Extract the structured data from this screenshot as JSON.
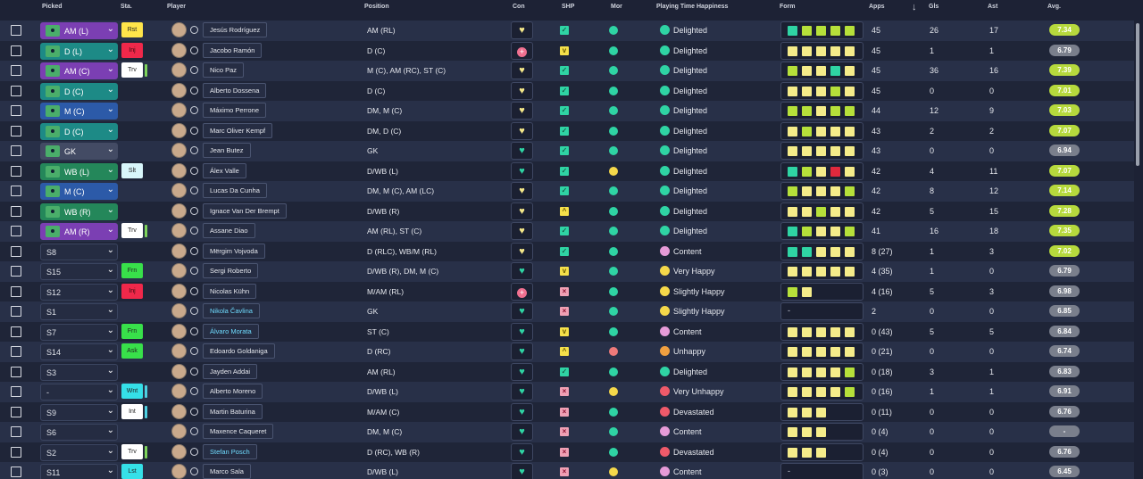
{
  "header": {
    "picked": "Picked",
    "sta": "Sta.",
    "player": "Player",
    "position": "Position",
    "con": "Con",
    "shp": "SHP",
    "mor": "Mor",
    "pth": "Playing Time Happiness",
    "form": "Form",
    "apps": "Apps",
    "sort": "↓",
    "gls": "Gls",
    "ast": "Ast",
    "avg": "Avg."
  },
  "colors": {
    "pick_purple": "#7b3fb3",
    "pick_teal": "#1d8a86",
    "pick_green": "#24875a",
    "pick_blue": "#2c5aa8",
    "pick_slate": "#434b64",
    "form_yellow": "#f5ec8a",
    "form_lime": "#b6e03a",
    "form_teal": "#2fd4a4",
    "form_red": "#e0293d",
    "sta_yellow": "#ffe54a",
    "sta_red": "#f0284a",
    "sta_white": "#ffffff",
    "sta_lightcyan": "#d8f6fa",
    "sta_green": "#38e04a",
    "sta_cyan": "#35e0e8"
  },
  "rows": [
    {
      "pick": "AM (L)",
      "pc": "purple",
      "sta": "Rst",
      "sc": "yellow",
      "bar": "",
      "name": "Jesús Rodríguez",
      "cyan": false,
      "pos": "AM (RL)",
      "con": "heart-yellow",
      "shp": "check",
      "mor": "teal",
      "pth": "Delighted",
      "pthc": "teal",
      "form": [
        "teal",
        "lime",
        "lime",
        "lime",
        "lime"
      ],
      "apps": "45",
      "gls": "26",
      "ast": "17",
      "avg": "7.34",
      "ac": "gr"
    },
    {
      "pick": "D (L)",
      "pc": "teal",
      "sta": "Inj",
      "sc": "red",
      "bar": "",
      "name": "Jacobo Ramón",
      "cyan": false,
      "pos": "D (C)",
      "con": "plus-red",
      "shp": "down",
      "mor": "teal",
      "pth": "Delighted",
      "pthc": "teal",
      "form": [
        "yellow",
        "yellow",
        "yellow",
        "yellow",
        "yellow"
      ],
      "apps": "45",
      "gls": "1",
      "ast": "1",
      "avg": "6.79",
      "ac": "gy"
    },
    {
      "pick": "AM (C)",
      "pc": "purple",
      "sta": "Trv",
      "sc": "white",
      "bar": "g",
      "name": "Nico Paz",
      "cyan": false,
      "pos": "M (C), AM (RC), ST (C)",
      "con": "heart-yellow",
      "shp": "check",
      "mor": "teal",
      "pth": "Delighted",
      "pthc": "teal",
      "form": [
        "lime",
        "yellow",
        "yellow",
        "teal",
        "yellow"
      ],
      "apps": "45",
      "gls": "36",
      "ast": "16",
      "avg": "7.39",
      "ac": "gr"
    },
    {
      "pick": "D (C)",
      "pc": "teal",
      "sta": "",
      "sc": "",
      "bar": "",
      "name": "Alberto Dossena",
      "cyan": false,
      "pos": "D (C)",
      "con": "heart-yellow",
      "shp": "check",
      "mor": "teal",
      "pth": "Delighted",
      "pthc": "teal",
      "form": [
        "yellow",
        "yellow",
        "yellow",
        "lime",
        "yellow"
      ],
      "apps": "45",
      "gls": "0",
      "ast": "0",
      "avg": "7.01",
      "ac": "gr"
    },
    {
      "pick": "M (C)",
      "pc": "blue",
      "sta": "",
      "sc": "",
      "bar": "",
      "name": "Máximo Perrone",
      "cyan": false,
      "pos": "DM, M (C)",
      "con": "heart-yellow",
      "shp": "check",
      "mor": "teal",
      "pth": "Delighted",
      "pthc": "teal",
      "form": [
        "lime",
        "lime",
        "yellow",
        "lime",
        "lime"
      ],
      "apps": "44",
      "gls": "12",
      "ast": "9",
      "avg": "7.03",
      "ac": "gr"
    },
    {
      "pick": "D (C)",
      "pc": "teal",
      "sta": "",
      "sc": "",
      "bar": "",
      "name": "Marc Oliver Kempf",
      "cyan": false,
      "pos": "DM, D (C)",
      "con": "heart-yellow",
      "shp": "check",
      "mor": "teal",
      "pth": "Delighted",
      "pthc": "teal",
      "form": [
        "yellow",
        "lime",
        "yellow",
        "yellow",
        "yellow"
      ],
      "apps": "43",
      "gls": "2",
      "ast": "2",
      "avg": "7.07",
      "ac": "gr"
    },
    {
      "pick": "GK",
      "pc": "slate",
      "sta": "",
      "sc": "",
      "bar": "",
      "name": "Jean Butez",
      "cyan": false,
      "pos": "GK",
      "con": "heart-teal",
      "shp": "check",
      "mor": "teal",
      "pth": "Delighted",
      "pthc": "teal",
      "form": [
        "yellow",
        "yellow",
        "yellow",
        "yellow",
        "yellow"
      ],
      "apps": "43",
      "gls": "0",
      "ast": "0",
      "avg": "6.94",
      "ac": "gy"
    },
    {
      "pick": "WB (L)",
      "pc": "green",
      "sta": "Slt",
      "sc": "lightcyan",
      "bar": "",
      "name": "Álex Valle",
      "cyan": false,
      "pos": "D/WB (L)",
      "con": "heart-teal",
      "shp": "check",
      "mor": "yellow",
      "pth": "Delighted",
      "pthc": "teal",
      "form": [
        "teal",
        "lime",
        "yellow",
        "red",
        "yellow"
      ],
      "apps": "42",
      "gls": "4",
      "ast": "11",
      "avg": "7.07",
      "ac": "gr"
    },
    {
      "pick": "M (C)",
      "pc": "blue",
      "sta": "",
      "sc": "",
      "bar": "",
      "name": "Lucas Da Cunha",
      "cyan": false,
      "pos": "DM, M (C), AM (LC)",
      "con": "heart-yellow",
      "shp": "check",
      "mor": "teal",
      "pth": "Delighted",
      "pthc": "teal",
      "form": [
        "lime",
        "yellow",
        "yellow",
        "yellow",
        "lime"
      ],
      "apps": "42",
      "gls": "8",
      "ast": "12",
      "avg": "7.14",
      "ac": "gr"
    },
    {
      "pick": "WB (R)",
      "pc": "green",
      "sta": "",
      "sc": "",
      "bar": "",
      "name": "Ignace Van Der Brempt",
      "cyan": false,
      "pos": "D/WB (R)",
      "con": "heart-yellow",
      "shp": "up",
      "mor": "teal",
      "pth": "Delighted",
      "pthc": "teal",
      "form": [
        "yellow",
        "yellow",
        "lime",
        "yellow",
        "yellow"
      ],
      "apps": "42",
      "gls": "5",
      "ast": "15",
      "avg": "7.28",
      "ac": "gr"
    },
    {
      "pick": "AM (R)",
      "pc": "purple",
      "sta": "Trv",
      "sc": "white",
      "bar": "y",
      "name": "Assane Diao",
      "cyan": false,
      "pos": "AM (RL), ST (C)",
      "con": "heart-yellow",
      "shp": "check",
      "mor": "teal",
      "pth": "Delighted",
      "pthc": "teal",
      "form": [
        "teal",
        "lime",
        "yellow",
        "yellow",
        "lime"
      ],
      "apps": "41",
      "gls": "16",
      "ast": "18",
      "avg": "7.35",
      "ac": "gr"
    },
    {
      "pick": "S8",
      "pc": "plain",
      "sta": "",
      "sc": "",
      "bar": "",
      "name": "Mërgim Vojvoda",
      "cyan": false,
      "pos": "D (RLC), WB/M (RL)",
      "con": "heart-yellow",
      "shp": "check",
      "mor": "teal",
      "pth": "Content",
      "pthc": "pink",
      "form": [
        "teal",
        "teal",
        "yellow",
        "yellow",
        "yellow"
      ],
      "apps": "8 (27)",
      "gls": "1",
      "ast": "3",
      "avg": "7.02",
      "ac": "gr"
    },
    {
      "pick": "S15",
      "pc": "plain",
      "sta": "Frn",
      "sc": "green",
      "bar": "",
      "name": "Sergi Roberto",
      "cyan": false,
      "pos": "D/WB (R), DM, M (C)",
      "con": "heart-teal",
      "shp": "down",
      "mor": "teal",
      "pth": "Very Happy",
      "pthc": "yellow",
      "form": [
        "yellow",
        "yellow",
        "yellow",
        "yellow",
        "yellow"
      ],
      "apps": "4 (35)",
      "gls": "1",
      "ast": "0",
      "avg": "6.79",
      "ac": "gy"
    },
    {
      "pick": "S12",
      "pc": "plain",
      "sta": "Inj",
      "sc": "red",
      "bar": "",
      "name": "Nicolas Kühn",
      "cyan": false,
      "pos": "M/AM (RL)",
      "con": "plus-red",
      "shp": "x",
      "mor": "teal",
      "pth": "Slightly Happy",
      "pthc": "yellow",
      "form": [
        "lime",
        "yellow"
      ],
      "apps": "4 (16)",
      "gls": "5",
      "ast": "3",
      "avg": "6.98",
      "ac": "gy"
    },
    {
      "pick": "S1",
      "pc": "plain",
      "sta": "",
      "sc": "",
      "bar": "",
      "name": "Nikola Čavlina",
      "cyan": true,
      "pos": "GK",
      "con": "heart-teal",
      "shp": "x",
      "mor": "teal",
      "pth": "Slightly Happy",
      "pthc": "yellow",
      "form": [],
      "apps": "2",
      "gls": "0",
      "ast": "0",
      "avg": "6.85",
      "ac": "gy"
    },
    {
      "pick": "S7",
      "pc": "plain",
      "sta": "Frn",
      "sc": "green",
      "bar": "",
      "name": "Álvaro Morata",
      "cyan": true,
      "pos": "ST (C)",
      "con": "heart-teal",
      "shp": "down",
      "mor": "teal",
      "pth": "Content",
      "pthc": "pink",
      "form": [
        "yellow",
        "yellow",
        "yellow",
        "yellow",
        "yellow"
      ],
      "apps": "0 (43)",
      "gls": "5",
      "ast": "5",
      "avg": "6.84",
      "ac": "gy"
    },
    {
      "pick": "S14",
      "pc": "plain",
      "sta": "Ask",
      "sc": "green",
      "bar": "",
      "name": "Edoardo Goldaniga",
      "cyan": false,
      "pos": "D (RC)",
      "con": "heart-teal",
      "shp": "up",
      "mor": "red",
      "pth": "Unhappy",
      "pthc": "orange",
      "form": [
        "yellow",
        "yellow",
        "yellow",
        "yellow",
        "yellow"
      ],
      "apps": "0 (21)",
      "gls": "0",
      "ast": "0",
      "avg": "6.74",
      "ac": "gy"
    },
    {
      "pick": "S3",
      "pc": "plain",
      "sta": "",
      "sc": "",
      "bar": "",
      "name": "Jayden Addai",
      "cyan": false,
      "pos": "AM (RL)",
      "con": "heart-teal",
      "shp": "check",
      "mor": "teal",
      "pth": "Delighted",
      "pthc": "teal",
      "form": [
        "yellow",
        "yellow",
        "yellow",
        "yellow",
        "lime"
      ],
      "apps": "0 (18)",
      "gls": "3",
      "ast": "1",
      "avg": "6.83",
      "ac": "gy"
    },
    {
      "pick": "-",
      "pc": "plain",
      "sta": "Wnt",
      "sc": "cyan",
      "bar": "c",
      "name": "Alberto Moreno",
      "cyan": false,
      "pos": "D/WB (L)",
      "con": "heart-teal",
      "shp": "x",
      "mor": "yellow",
      "pth": "Very Unhappy",
      "pthc": "red",
      "form": [
        "yellow",
        "yellow",
        "yellow",
        "yellow",
        "lime"
      ],
      "apps": "0 (16)",
      "gls": "1",
      "ast": "1",
      "avg": "6.91",
      "ac": "gy"
    },
    {
      "pick": "S9",
      "pc": "plain",
      "sta": "Int",
      "sc": "white",
      "bar": "c",
      "name": "Martin Baturina",
      "cyan": false,
      "pos": "M/AM (C)",
      "con": "heart-teal",
      "shp": "x",
      "mor": "teal",
      "pth": "Devastated",
      "pthc": "red",
      "form": [
        "yellow",
        "yellow",
        "yellow"
      ],
      "apps": "0 (11)",
      "gls": "0",
      "ast": "0",
      "avg": "6.76",
      "ac": "gy"
    },
    {
      "pick": "S6",
      "pc": "plain",
      "sta": "",
      "sc": "",
      "bar": "",
      "name": "Maxence Caqueret",
      "cyan": false,
      "pos": "DM, M (C)",
      "con": "heart-teal",
      "shp": "x",
      "mor": "teal",
      "pth": "Content",
      "pthc": "pink",
      "form": [
        "yellow",
        "yellow",
        "yellow"
      ],
      "apps": "0 (4)",
      "gls": "0",
      "ast": "0",
      "avg": "-",
      "ac": "gy"
    },
    {
      "pick": "S2",
      "pc": "plain",
      "sta": "Trv",
      "sc": "white",
      "bar": "g",
      "name": "Stefan Posch",
      "cyan": true,
      "pos": "D (RC), WB (R)",
      "con": "heart-teal",
      "shp": "x",
      "mor": "teal",
      "pth": "Devastated",
      "pthc": "red",
      "form": [
        "yellow",
        "yellow",
        "yellow"
      ],
      "apps": "0 (4)",
      "gls": "0",
      "ast": "0",
      "avg": "6.76",
      "ac": "gy"
    },
    {
      "pick": "S11",
      "pc": "plain",
      "sta": "Lst",
      "sc": "cyan",
      "bar": "",
      "name": "Marco Sala",
      "cyan": false,
      "pos": "D/WB (L)",
      "con": "heart-teal",
      "shp": "x",
      "mor": "yellow",
      "pth": "Content",
      "pthc": "pink",
      "form": [],
      "apps": "0 (3)",
      "gls": "0",
      "ast": "0",
      "avg": "6.45",
      "ac": "gy"
    }
  ]
}
